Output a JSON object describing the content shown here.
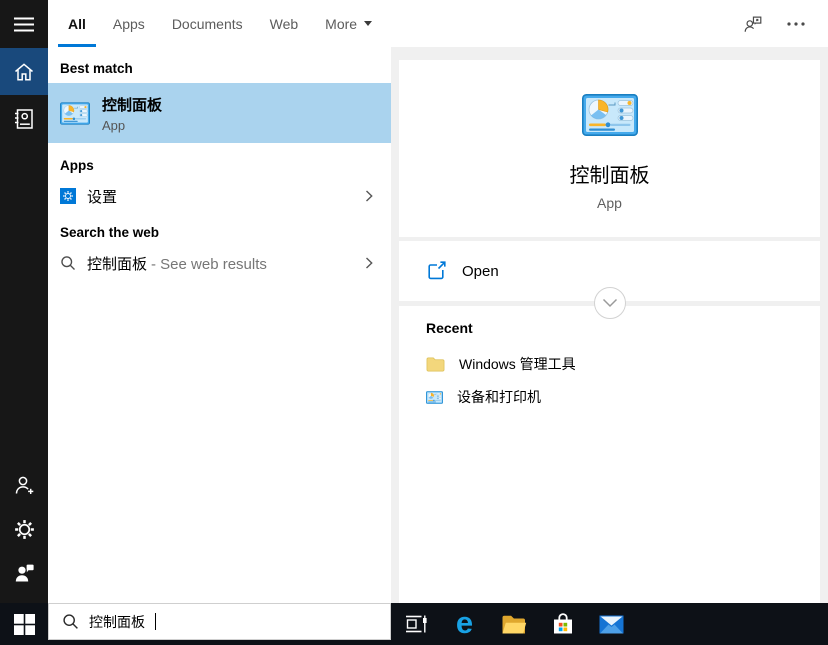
{
  "header": {
    "tabs": [
      {
        "label": "All",
        "active": true
      },
      {
        "label": "Apps",
        "active": false
      },
      {
        "label": "Documents",
        "active": false
      },
      {
        "label": "Web",
        "active": false
      },
      {
        "label": "More",
        "active": false,
        "has_dropdown": true
      }
    ]
  },
  "left_panel": {
    "best_match_header": "Best match",
    "best_match": {
      "title": "控制面板",
      "type": "App",
      "icon": "control-panel-icon"
    },
    "apps_header": "Apps",
    "apps": [
      {
        "label": "设置",
        "icon": "settings-gear-icon"
      }
    ],
    "web_header": "Search the web",
    "web_result": {
      "query": "控制面板",
      "suffix": " - See web results",
      "icon": "search-icon"
    }
  },
  "preview": {
    "title": "控制面板",
    "type": "App",
    "icon": "control-panel-icon",
    "open_label": "Open",
    "recent_header": "Recent",
    "recent": [
      {
        "label": "Windows 管理工具",
        "icon": "folder-icon"
      },
      {
        "label": "设备和打印机",
        "icon": "control-panel-icon"
      }
    ]
  },
  "taskbar": {
    "search_value": "控制面板",
    "buttons": [
      "start",
      "task-view",
      "edge",
      "file-explorer",
      "store",
      "mail"
    ]
  },
  "sidebar_icons": [
    "hamburger-icon",
    "home-icon",
    "journal-icon",
    "person-add-icon",
    "gear-icon",
    "feedback-icon"
  ],
  "colors": {
    "accent": "#0078d7",
    "best_match_highlight": "#aad3ee",
    "sidebar_bg": "#171717",
    "sidebar_selected": "#19497c",
    "taskbar_bg": "#0d1117",
    "preview_panel_bg": "#f0f0f0",
    "orange": "#f9b52a"
  }
}
